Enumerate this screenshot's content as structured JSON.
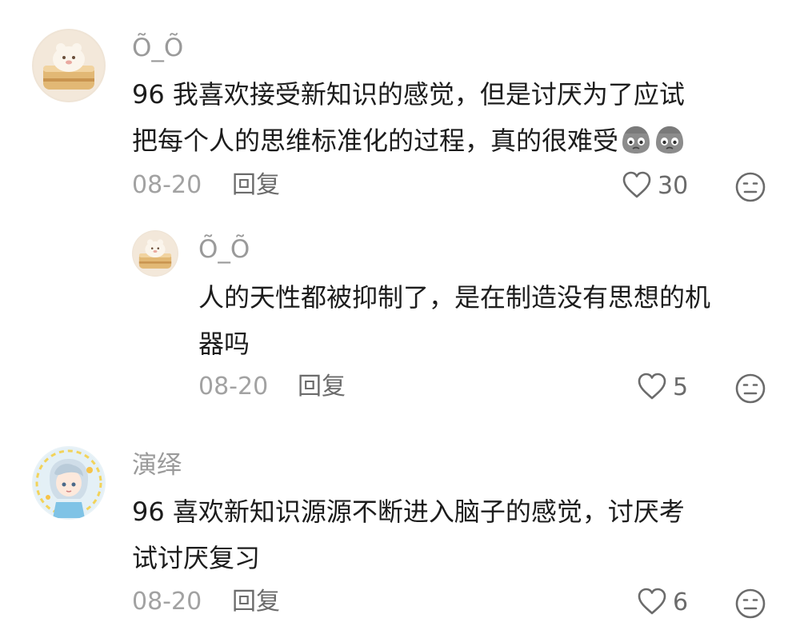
{
  "comments": [
    {
      "username": "Õ_Õ",
      "lines": [
        "96 我喜欢接受新知识的感觉，但是讨厌为了应试",
        "把每个人的思维标准化的过程，真的很难受"
      ],
      "date": "08-20",
      "reply_label": "回复",
      "likes": "30",
      "emoji_icon": "sad-face-emoji-icon"
    },
    {
      "username": "Õ_Õ",
      "lines": [
        "人的天性都被抑制了，是在制造没有思想的机",
        "器吗"
      ],
      "date": "08-20",
      "reply_label": "回复",
      "likes": "5"
    },
    {
      "username": "演绎",
      "lines": [
        "96 喜欢新知识源源不断进入脑子的感觉，讨厌考",
        "试讨厌复习"
      ],
      "date": "08-20",
      "reply_label": "回复",
      "likes": "6"
    }
  ],
  "icons": {
    "like": "heart-outline-icon",
    "dislike": "meh-face-icon"
  },
  "colors": {
    "username": "#9a9a9a",
    "body": "#1c1c1c",
    "meta": "#a2a2a2",
    "action": "#6b6b6b"
  }
}
